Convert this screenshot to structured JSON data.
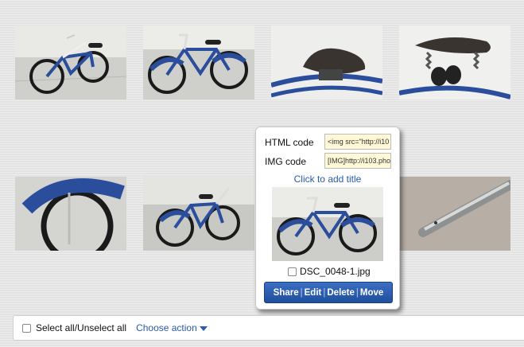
{
  "gallery": {
    "thumbnails": [
      {
        "icon": "bicycle-photo"
      },
      {
        "icon": "bicycle-photo"
      },
      {
        "icon": "saddle-photo"
      },
      {
        "icon": "saddle-springs-photo"
      },
      {
        "icon": "front-fender-photo"
      },
      {
        "icon": "bicycle-photo"
      },
      {
        "icon": "chrome-tube-photo"
      }
    ]
  },
  "popup": {
    "html_label": "HTML code",
    "html_value": "<img src=\"http://i10",
    "img_label": "IMG code",
    "img_value": "[IMG]http://i103.pho",
    "add_title": "Click to add title",
    "filename": "DSC_0048-1.jpg",
    "actions": {
      "share": "Share",
      "edit": "Edit",
      "delete": "Delete",
      "move": "Move",
      "separator": "|"
    }
  },
  "bottom_bar": {
    "select_all": "Select all/Unselect all",
    "choose_action": "Choose action"
  },
  "colors": {
    "link": "#2a5aa8",
    "button": "#2856a6",
    "field_bg": "#fff8d6"
  }
}
